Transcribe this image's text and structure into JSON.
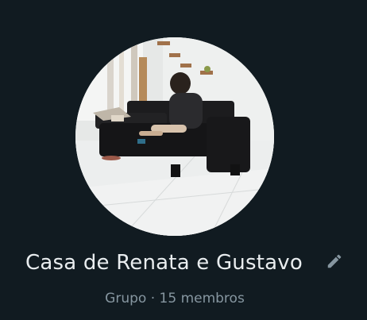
{
  "group": {
    "name": "Casa de Renata e Gustavo",
    "type_label": "Grupo",
    "separator": " · ",
    "members_label": "15 membros"
  },
  "icons": {
    "edit": "pencil-icon"
  },
  "colors": {
    "background": "#111b21",
    "primary_text": "#e9edef",
    "secondary_text": "#8696a0",
    "icon": "#8696a0"
  }
}
